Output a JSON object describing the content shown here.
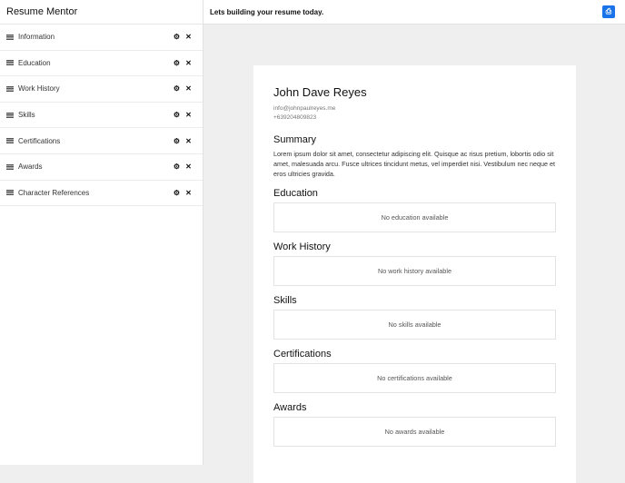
{
  "sidebar": {
    "title": "Resume Mentor",
    "items": [
      {
        "label": "Information"
      },
      {
        "label": "Education"
      },
      {
        "label": "Work History"
      },
      {
        "label": "Skills"
      },
      {
        "label": "Certifications"
      },
      {
        "label": "Awards"
      },
      {
        "label": "Character References"
      }
    ]
  },
  "topbar": {
    "message": "Lets building your resume today."
  },
  "resume": {
    "name": "John Dave Reyes",
    "email": "info@johnpaulreyes.me",
    "phone": "+639204809823",
    "summary_title": "Summary",
    "summary": "Lorem ipsum dolor sit amet, consectetur adipiscing elit. Quisque ac risus pretium, lobortis odio sit amet, malesuada arcu. Fusce ultrices tincidunt metus, vel imperdiet nisi. Vestibulum nec neque et eros ultricies gravida.",
    "sections": [
      {
        "title": "Education",
        "empty": "No education available"
      },
      {
        "title": "Work History",
        "empty": "No work history available"
      },
      {
        "title": "Skills",
        "empty": "No skills available"
      },
      {
        "title": "Certifications",
        "empty": "No certifications available"
      },
      {
        "title": "Awards",
        "empty": "No awards available"
      }
    ]
  },
  "colors": {
    "accent": "#1a73e8"
  }
}
